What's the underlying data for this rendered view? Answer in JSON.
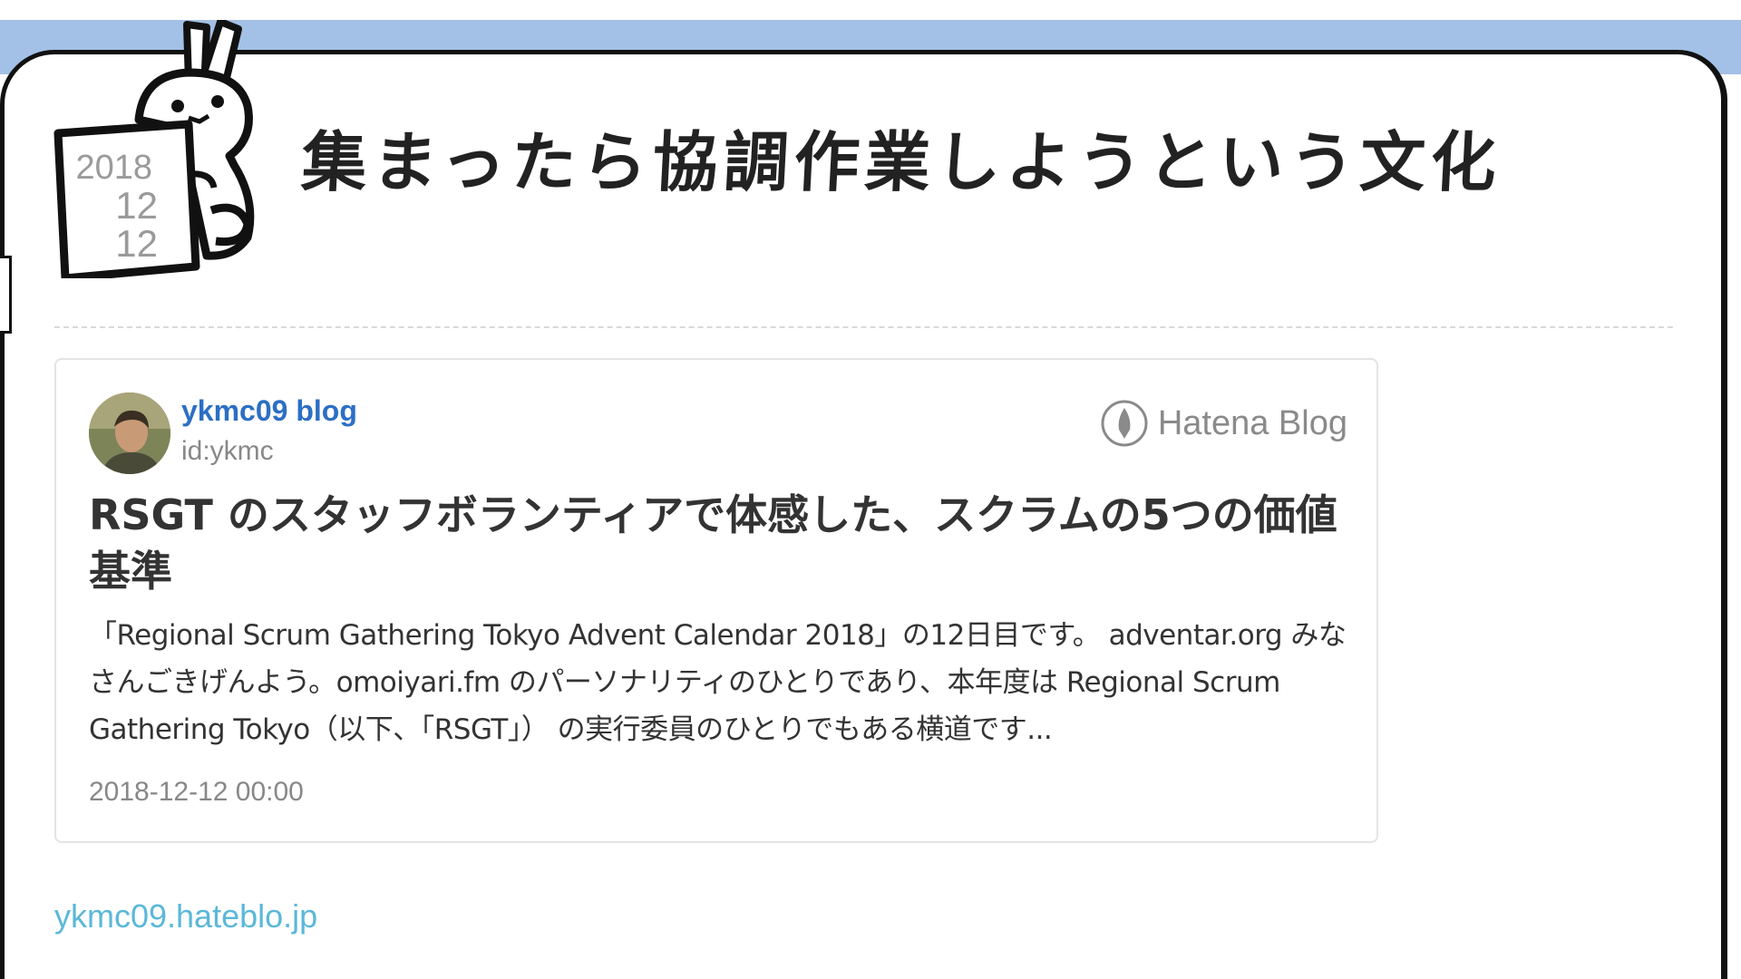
{
  "header": {
    "calendar_year": "2018",
    "calendar_month": "12",
    "calendar_day": "12",
    "heading": "集まったら協調作業しようという文化"
  },
  "embed": {
    "blog_name": "ykmc09 blog",
    "author_id": "id:ykmc",
    "service_name": "Hatena Blog",
    "title": "RSGT のスタッフボランティアで体感した、スクラムの5つの価値基準",
    "excerpt": "「Regional Scrum Gathering Tokyo Advent Calendar 2018」の12日目です。 adventar.org みなさんごきげんよう。omoiyari.fm のパーソナリティのひとりであり、本年度は Regional Scrum Gathering Tokyo（以下、「RSGT」） の実行委員のひとりでもある横道です...",
    "date": "2018-12-12 00:00"
  },
  "footer": {
    "link_text": "ykmc09.hateblo.jp"
  },
  "colors": {
    "top_band": "#a3c0e6",
    "blog_name": "#2c6fc4",
    "link": "#5bb8d8",
    "muted_text": "#888888"
  }
}
